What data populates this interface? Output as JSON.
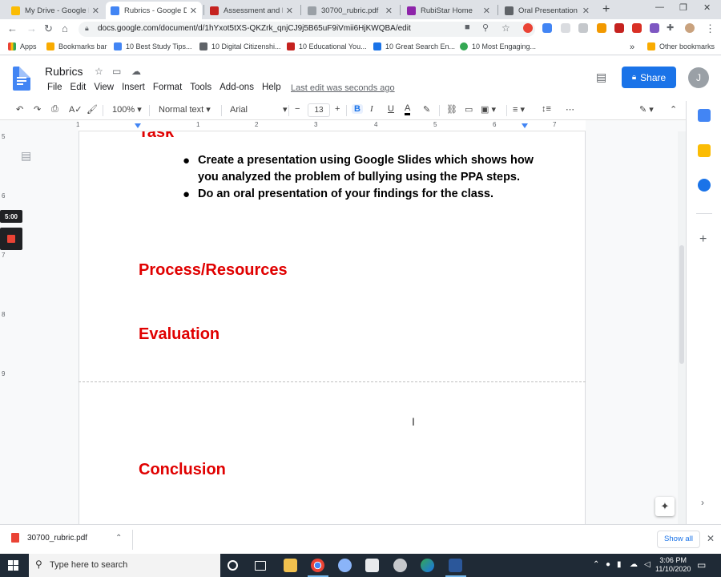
{
  "browser": {
    "tabs": [
      {
        "title": "My Drive - Google D",
        "color": "#fbbc04"
      },
      {
        "title": "Rubrics - Google Do",
        "color": "#4285f4",
        "active": true
      },
      {
        "title": "Assessment and Rub",
        "color": "#c5221f"
      },
      {
        "title": "30700_rubric.pdf",
        "color": "#9aa0a6"
      },
      {
        "title": "RubiStar Home",
        "color": "#8e24aa"
      },
      {
        "title": "Oral Presentation R",
        "color": "#5f6368"
      }
    ],
    "url": "docs.google.com/document/d/1hYxot5tXS-QKZrk_qnjCJ9j5B65uF9iVmii6HjKWQBA/edit",
    "bookmarks": [
      "Apps",
      "Bookmarks bar",
      "10 Best Study Tips...",
      "10 Digital Citizenshi...",
      "10 Educational You...",
      "10 Great Search En...",
      "10 Most Engaging..."
    ],
    "bookmarks_more": "»",
    "other_bookmarks": "Other bookmarks"
  },
  "docs": {
    "title": "Rubrics",
    "menu": [
      "File",
      "Edit",
      "View",
      "Insert",
      "Format",
      "Tools",
      "Add-ons",
      "Help"
    ],
    "last_edit": "Last edit was seconds ago",
    "share_label": "Share",
    "avatar_initial": "J",
    "toolbar": {
      "zoom": "100%",
      "style": "Normal text",
      "font": "Arial",
      "size": "13"
    },
    "ruler_numbers": [
      "1",
      "1",
      "2",
      "3",
      "4",
      "5",
      "6",
      "7"
    ],
    "vruler_numbers": [
      "5",
      "6",
      "7",
      "8",
      "9"
    ]
  },
  "recorder": {
    "timer": "5:00"
  },
  "document": {
    "partial_heading": "Task",
    "bullets": [
      "Create a presentation using Google Slides which shows how you analyzed the problem of bullying using the PPA steps.",
      "Do an oral presentation of your findings for the class."
    ],
    "headings": {
      "process": "Process/Resources",
      "evaluation": "Evaluation",
      "conclusion": "Conclusion"
    }
  },
  "downloads": {
    "file": "30700_rubric.pdf",
    "show_all": "Show all"
  },
  "taskbar": {
    "search_placeholder": "Type here to search",
    "time": "3:06 PM",
    "date": "11/10/2020"
  },
  "colors": {
    "heading_red": "#e00000",
    "share_blue": "#1a73e8",
    "docs_blue": "#4285f4"
  }
}
